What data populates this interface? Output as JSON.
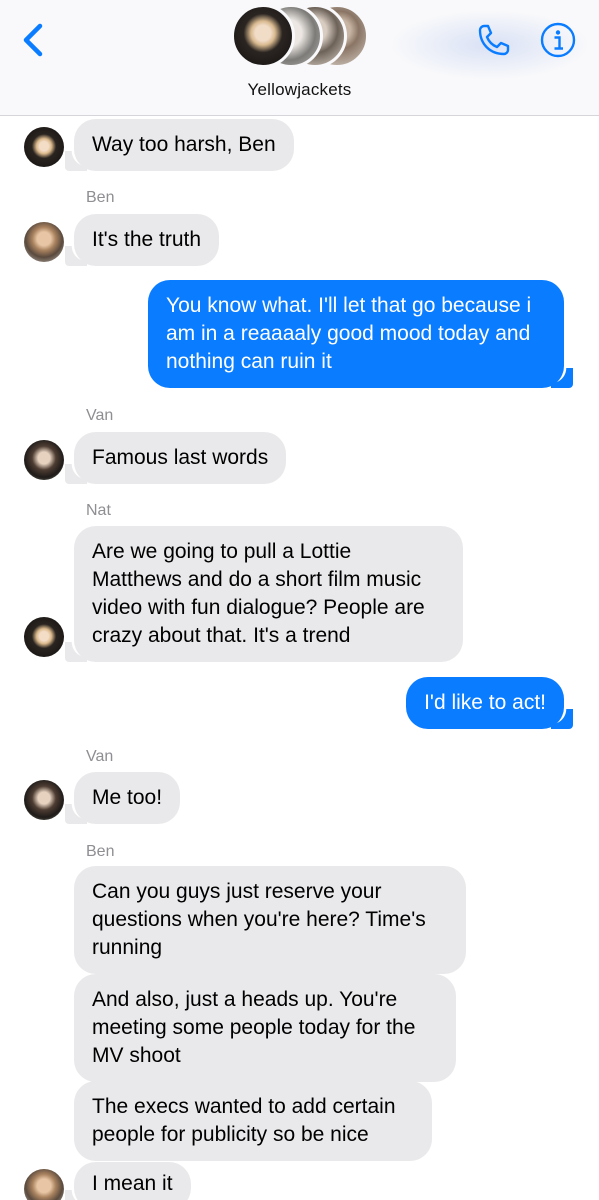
{
  "header": {
    "title": "Yellowjackets",
    "back_icon": "chevron-left-icon",
    "call_icon": "phone-icon",
    "info_icon": "info-icon",
    "accent_color": "#0a7cff"
  },
  "messages": [
    {
      "sender": "",
      "direction": "incoming",
      "text": "Way too harsh, Ben"
    },
    {
      "sender": "Ben",
      "direction": "incoming",
      "text": "It's the truth"
    },
    {
      "sender": "",
      "direction": "outgoing",
      "text": "You know what. I'll let that go because i am in a reaaaaly good mood today and nothing can ruin it"
    },
    {
      "sender": "Van",
      "direction": "incoming",
      "text": "Famous last words"
    },
    {
      "sender": "Nat",
      "direction": "incoming",
      "text": "Are we going to pull a Lottie Matthews and do a short film music video with fun dialogue? People are crazy about that. It's a trend"
    },
    {
      "sender": "",
      "direction": "outgoing",
      "text": "I'd like to act!"
    },
    {
      "sender": "Van",
      "direction": "incoming",
      "text": "Me too!"
    },
    {
      "sender": "Ben",
      "direction": "incoming",
      "text": "Can you guys just reserve your questions when you're here? Time's running"
    },
    {
      "sender": "",
      "direction": "incoming",
      "text": "And also, just a heads up. You're meeting some people today for the MV shoot"
    },
    {
      "sender": "",
      "direction": "incoming",
      "text": "The execs wanted to add certain people for publicity so be nice"
    },
    {
      "sender": "",
      "direction": "incoming",
      "text": "I mean it"
    }
  ]
}
